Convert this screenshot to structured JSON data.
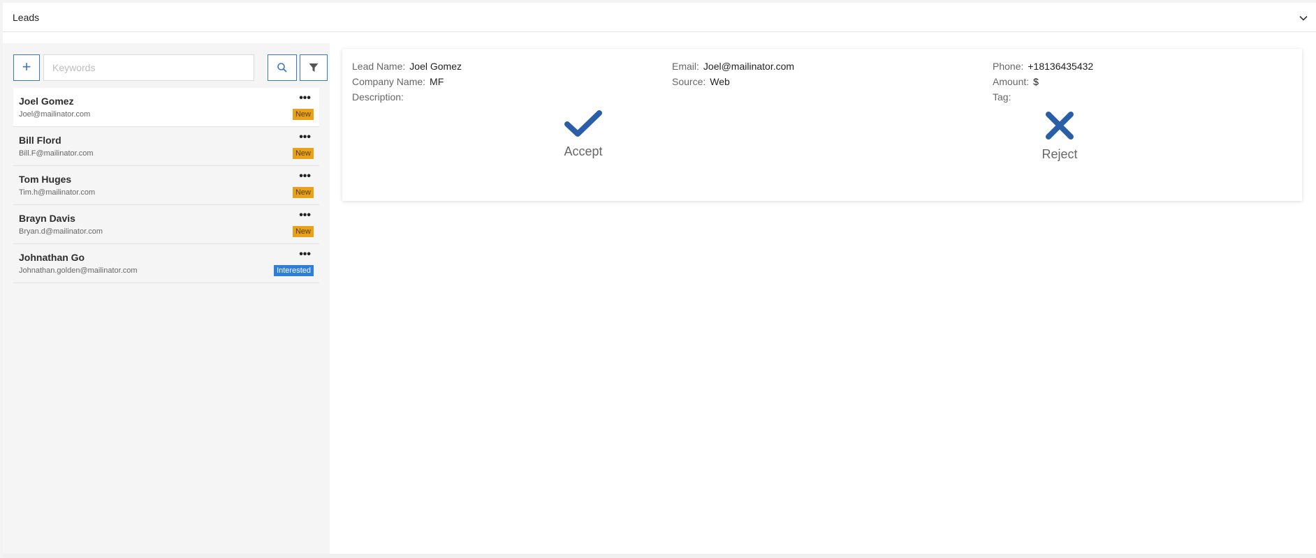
{
  "header": {
    "title": "Leads"
  },
  "sidebar": {
    "search": {
      "placeholder": "Keywords",
      "value": ""
    },
    "leads": [
      {
        "name": "Joel Gomez",
        "email": "Joel@mailinator.com",
        "status": "New",
        "status_kind": "new"
      },
      {
        "name": "Bill Flord",
        "email": "Bill.F@mailinator.com",
        "status": "New",
        "status_kind": "new"
      },
      {
        "name": "Tom Huges",
        "email": "Tim.h@mailinator.com",
        "status": "New",
        "status_kind": "new"
      },
      {
        "name": "Brayn Davis",
        "email": "Bryan.d@mailinator.com",
        "status": "New",
        "status_kind": "new"
      },
      {
        "name": "Johnathan Go",
        "email": "Johnathan.golden@mailinator.com",
        "status": "Interested",
        "status_kind": "interested"
      }
    ],
    "more_label": "•••"
  },
  "detail": {
    "lead_name_label": "Lead Name:",
    "lead_name": "Joel Gomez",
    "company_label": "Company Name:",
    "company": "MF",
    "description_label": "Description:",
    "description": "",
    "email_label": "Email:",
    "email": "Joel@mailinator.com",
    "source_label": "Source:",
    "source": "Web",
    "phone_label": "Phone:",
    "phone": "+18136435432",
    "amount_label": "Amount:",
    "amount": "$",
    "tag_label": "Tag:",
    "tag": "",
    "accept_label": "Accept",
    "reject_label": "Reject"
  },
  "colors": {
    "accent": "#3a78c4",
    "action": "#2a5fa8",
    "badge_new": "#e8a21a",
    "badge_interested": "#2f7fd8"
  },
  "icons": {
    "add": "plus-icon",
    "search": "search-icon",
    "filter": "filter-icon",
    "accept": "check-icon",
    "reject": "close-icon",
    "collapse": "chevron-down-icon"
  }
}
